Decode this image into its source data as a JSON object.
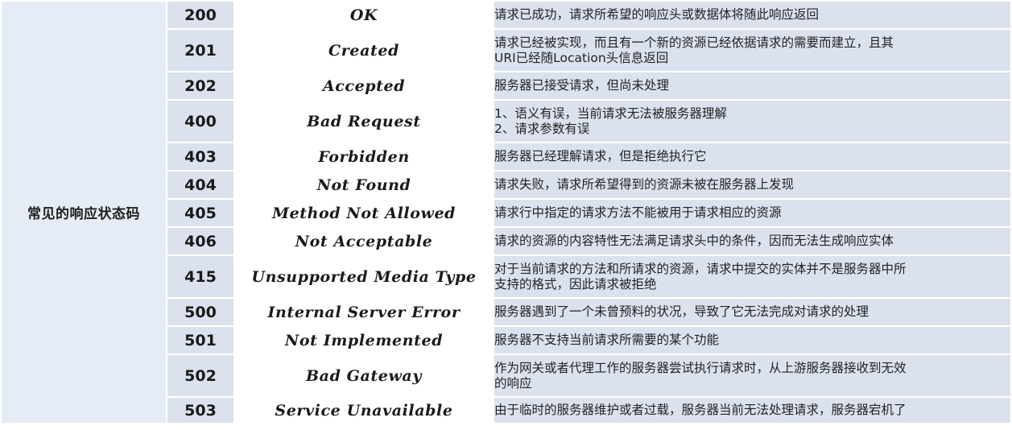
{
  "category_label": "常见的响应状态码",
  "rows": [
    {
      "code": "200",
      "phrase": "OK",
      "lines": [
        "请求已成功，请求所希望的响应头或数据体将随此响应返回"
      ]
    },
    {
      "code": "201",
      "phrase": "Created",
      "lines": [
        "请求已经被实现，而且有一个新的资源已经依据请求的需要而建立，且其",
        "URI已经随Location头信息返回"
      ]
    },
    {
      "code": "202",
      "phrase": "Accepted",
      "lines": [
        "服务器已接受请求，但尚未处理"
      ]
    },
    {
      "code": "400",
      "phrase": "Bad Request",
      "lines": [
        "1、语义有误，当前请求无法被服务器理解",
        "2、请求参数有误"
      ]
    },
    {
      "code": "403",
      "phrase": "Forbidden",
      "lines": [
        "服务器已经理解请求，但是拒绝执行它"
      ]
    },
    {
      "code": "404",
      "phrase": "Not Found",
      "lines": [
        "请求失败，请求所希望得到的资源未被在服务器上发现"
      ]
    },
    {
      "code": "405",
      "phrase": "Method Not Allowed",
      "lines": [
        "请求行中指定的请求方法不能被用于请求相应的资源"
      ]
    },
    {
      "code": "406",
      "phrase": "Not Acceptable",
      "lines": [
        "请求的资源的内容特性无法满足请求头中的条件，因而无法生成响应实体"
      ]
    },
    {
      "code": "415",
      "phrase": "Unsupported Media Type",
      "lines": [
        "对于当前请求的方法和所请求的资源，请求中提交的实体并不是服务器中所",
        "支持的格式，因此请求被拒绝"
      ]
    },
    {
      "code": "500",
      "phrase": "Internal Server Error",
      "lines": [
        "服务器遇到了一个未曾预料的状况，导致了它无法完成对请求的处理"
      ]
    },
    {
      "code": "501",
      "phrase": "Not Implemented",
      "lines": [
        "服务器不支持当前请求所需要的某个功能"
      ]
    },
    {
      "code": "502",
      "phrase": "Bad Gateway",
      "lines": [
        "作为网关或者代理工作的服务器尝试执行请求时，从上游服务器接收到无效",
        "的响应"
      ]
    },
    {
      "code": "503",
      "phrase": "Service Unavailable",
      "lines": [
        "由于临时的服务器维护或者过载，服务器当前无法处理请求，服务器宕机了"
      ]
    }
  ],
  "colors": {
    "category_bg": "#e6ecf5",
    "code_bg": "#dbe2ee",
    "phrase_bg": "#ffffff",
    "desc_bg": "#dbe2ee"
  }
}
